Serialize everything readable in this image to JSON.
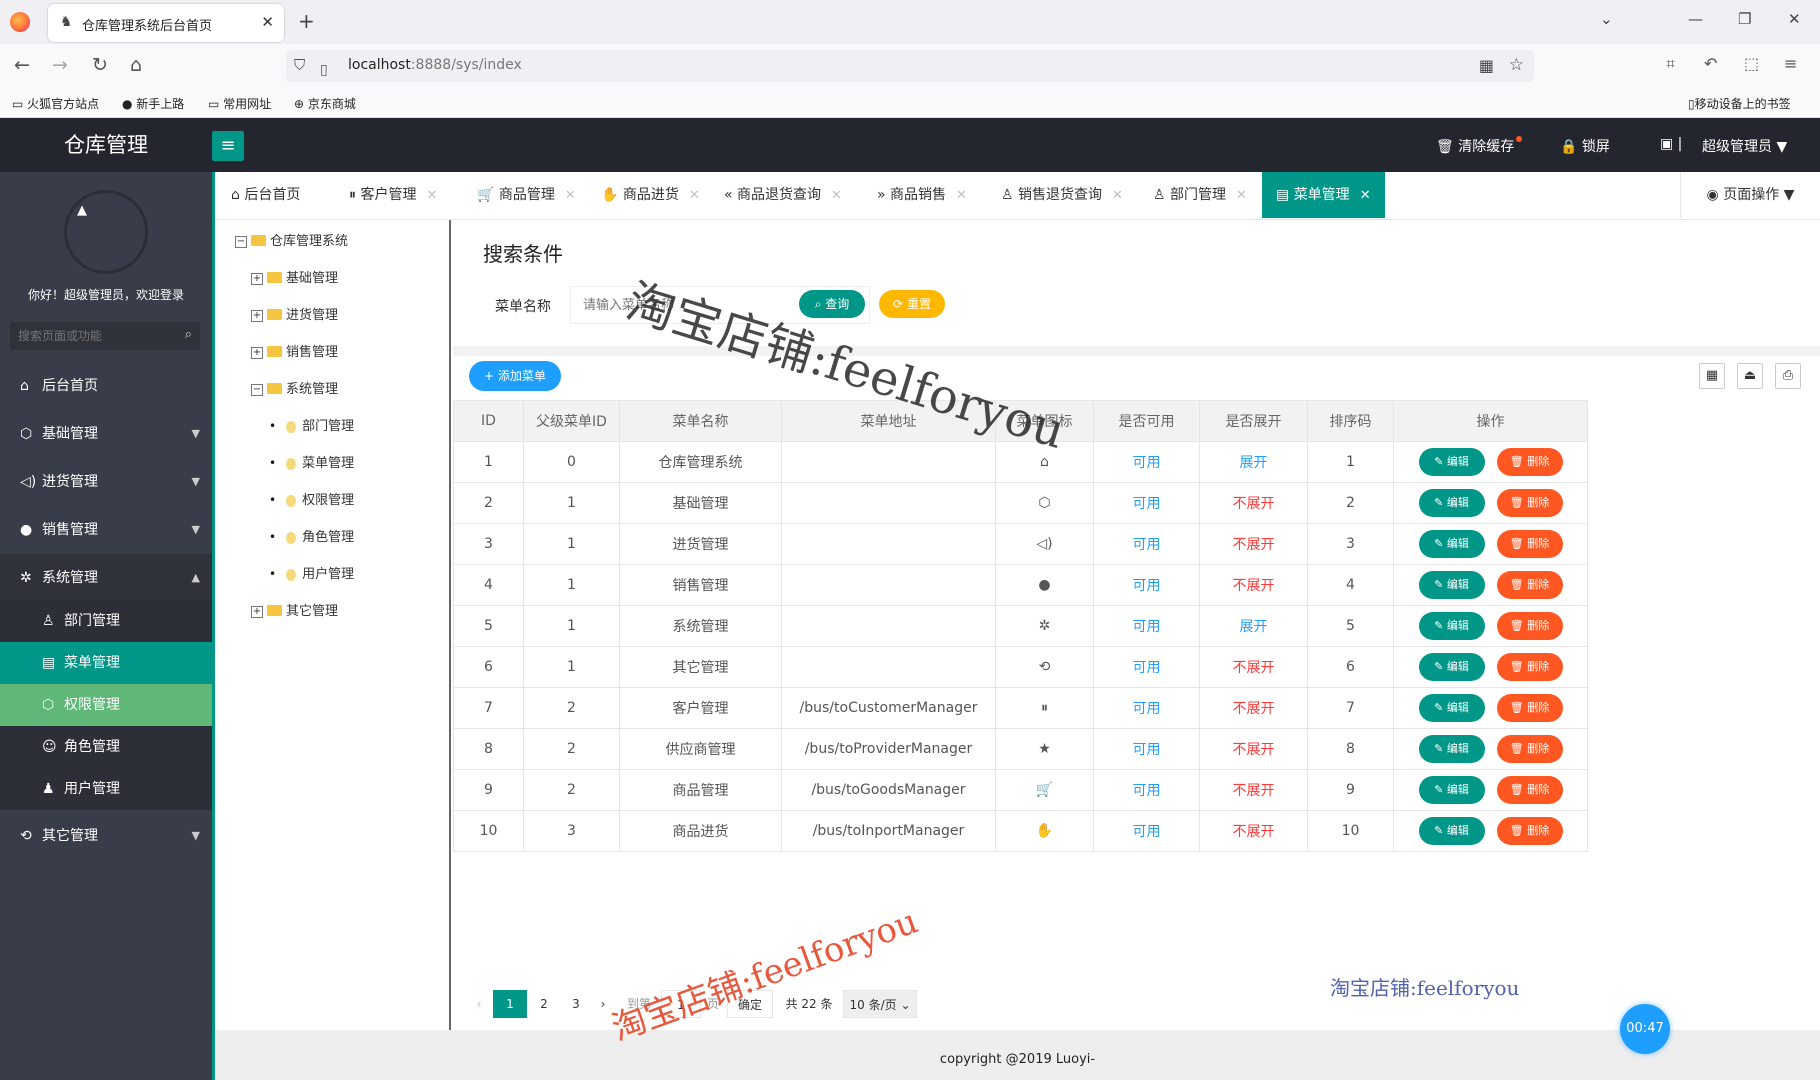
{
  "browser": {
    "tab_title": "仓库管理系统后台首页",
    "url_host": "localhost",
    "url_rest": ":8888/sys/index",
    "bookmarks": [
      "火狐官方站点",
      "新手上路",
      "常用网址",
      "京东商城"
    ],
    "mobile_bookmarks": "移动设备上的书签"
  },
  "header": {
    "logo": "仓库管理",
    "clear_cache": "清除缓存",
    "lock": "锁屏",
    "user": "超级管理员"
  },
  "sidebar": {
    "welcome": "你好！超级管理员，欢迎登录",
    "search_placeholder": "搜索页面或功能",
    "items": {
      "home": "后台首页",
      "basic": "基础管理",
      "purchase": "进货管理",
      "sales": "销售管理",
      "system": "系统管理",
      "dept": "部门管理",
      "menu": "菜单管理",
      "perm": "权限管理",
      "role": "角色管理",
      "user": "用户管理",
      "other": "其它管理"
    }
  },
  "tabs": [
    "后台首页",
    "客户管理",
    "商品管理",
    "商品进货",
    "商品退货查询",
    "商品销售",
    "销售退货查询",
    "部门管理",
    "菜单管理"
  ],
  "page_ops": "页面操作",
  "tree": {
    "root": "仓库管理系统",
    "basic": "基础管理",
    "purchase": "进货管理",
    "sales": "销售管理",
    "system": "系统管理",
    "children": [
      "部门管理",
      "菜单管理",
      "权限管理",
      "角色管理",
      "用户管理"
    ],
    "other": "其它管理"
  },
  "search": {
    "title": "搜索条件",
    "label": "菜单名称",
    "placeholder": "请输入菜单名称",
    "query": "查询",
    "reset": "重置"
  },
  "add_button": "添加菜单",
  "table": {
    "headers": [
      "ID",
      "父级菜单ID",
      "菜单名称",
      "菜单地址",
      "菜单图标",
      "是否可用",
      "是否展开",
      "排序码",
      "操作"
    ],
    "edit": "编辑",
    "delete": "删除",
    "rows": [
      {
        "id": "1",
        "pid": "0",
        "name": "仓库管理系统",
        "url": "",
        "icon": "home-icon",
        "avail": "可用",
        "open": "展开",
        "sort": "1"
      },
      {
        "id": "2",
        "pid": "1",
        "name": "基础管理",
        "url": "",
        "icon": "cube-icon",
        "avail": "可用",
        "open": "不展开",
        "sort": "2"
      },
      {
        "id": "3",
        "pid": "1",
        "name": "进货管理",
        "url": "",
        "icon": "speaker-icon",
        "avail": "可用",
        "open": "不展开",
        "sort": "3"
      },
      {
        "id": "4",
        "pid": "1",
        "name": "销售管理",
        "url": "",
        "icon": "chat-icon",
        "avail": "可用",
        "open": "不展开",
        "sort": "4"
      },
      {
        "id": "5",
        "pid": "1",
        "name": "系统管理",
        "url": "",
        "icon": "gear-icon",
        "avail": "可用",
        "open": "展开",
        "sort": "5"
      },
      {
        "id": "6",
        "pid": "1",
        "name": "其它管理",
        "url": "",
        "icon": "refresh-icon",
        "avail": "可用",
        "open": "不展开",
        "sort": "6"
      },
      {
        "id": "7",
        "pid": "2",
        "name": "客户管理",
        "url": "/bus/toCustomerManager",
        "icon": "pause-icon",
        "avail": "可用",
        "open": "不展开",
        "sort": "7"
      },
      {
        "id": "8",
        "pid": "2",
        "name": "供应商管理",
        "url": "/bus/toProviderManager",
        "icon": "star-icon",
        "avail": "可用",
        "open": "不展开",
        "sort": "8"
      },
      {
        "id": "9",
        "pid": "2",
        "name": "商品管理",
        "url": "/bus/toGoodsManager",
        "icon": "cart-icon",
        "avail": "可用",
        "open": "不展开",
        "sort": "9"
      },
      {
        "id": "10",
        "pid": "3",
        "name": "商品进货",
        "url": "/bus/toInportManager",
        "icon": "fire-icon",
        "avail": "可用",
        "open": "不展开",
        "sort": "10"
      }
    ]
  },
  "pager": {
    "pages": [
      "1",
      "2",
      "3"
    ],
    "goto_label": "到第",
    "goto_value": "1",
    "page_unit": "页",
    "confirm": "确定",
    "total": "共 22 条",
    "size": "10 条/页"
  },
  "footer": "copyright @2019 Luoyi-",
  "timer": "00:47",
  "watermark": "淘宝店铺:feelforyou"
}
